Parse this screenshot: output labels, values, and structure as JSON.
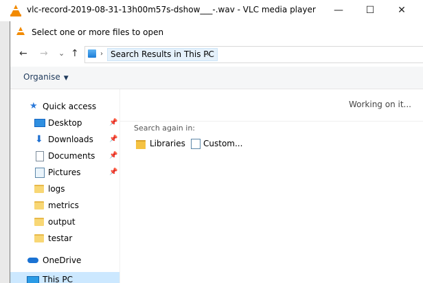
{
  "vlc_window": {
    "title": "vlc-record-2019-08-31-13h00m57s-dshow___-.wav - VLC media player",
    "buttons": {
      "minimize": "—",
      "maximize": "☐",
      "close": "✕"
    }
  },
  "dialog": {
    "title": "Select one or more files to open",
    "address": {
      "back": "←",
      "forward": "→",
      "recent": "⌄",
      "up": "↑",
      "breadcrumb": "Search Results in This PC"
    },
    "toolbar": {
      "organise": "Organise"
    },
    "nav": {
      "quick_access": "Quick access",
      "items": [
        {
          "label": "Desktop",
          "pinned": true
        },
        {
          "label": "Downloads",
          "pinned": true
        },
        {
          "label": "Documents",
          "pinned": true
        },
        {
          "label": "Pictures",
          "pinned": true
        },
        {
          "label": "logs",
          "pinned": false
        },
        {
          "label": "metrics",
          "pinned": false
        },
        {
          "label": "output",
          "pinned": false
        },
        {
          "label": "testar",
          "pinned": false
        }
      ],
      "onedrive": "OneDrive",
      "this_pc": "This PC"
    },
    "content": {
      "status": "Working on it...",
      "search_again_label": "Search again in:",
      "links": [
        "Libraries",
        "Custom..."
      ]
    }
  },
  "colors": {
    "vlc_orange": "#f28a00",
    "selection": "#cce8ff",
    "breadcrumb_bg": "#e5f1fb",
    "link_text": "#1e395b"
  }
}
